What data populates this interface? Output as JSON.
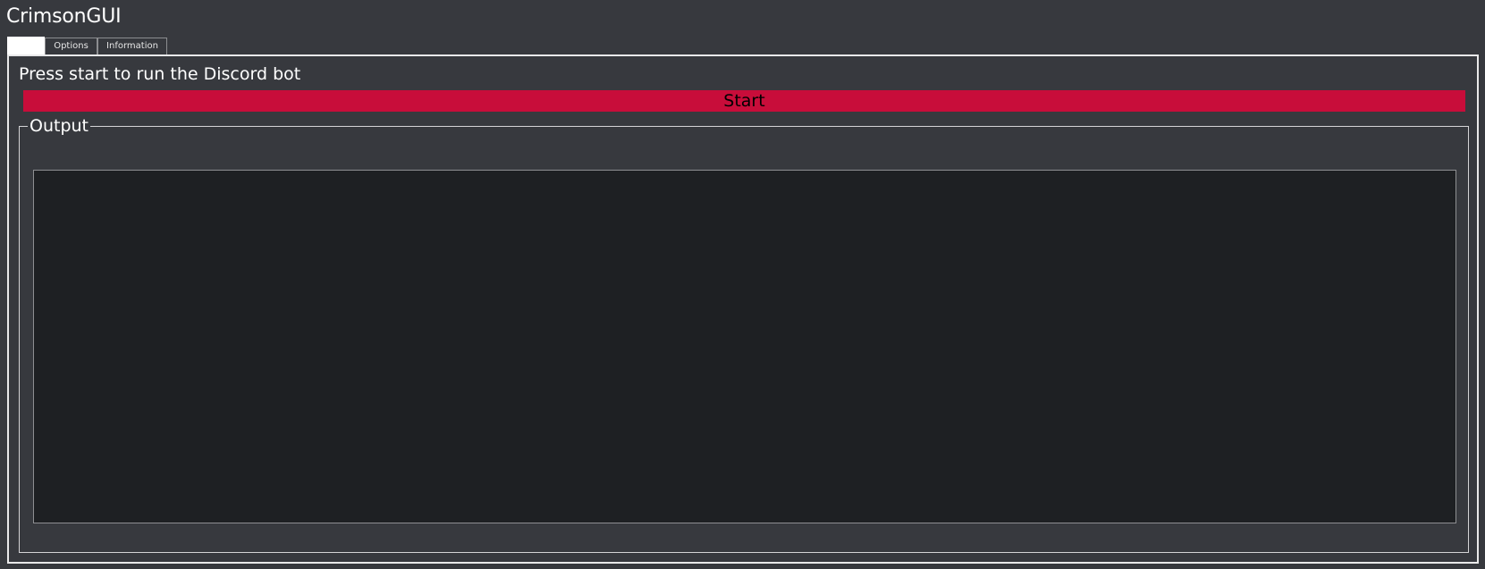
{
  "window": {
    "title": "CrimsonGUI"
  },
  "tabs": [
    {
      "label": "",
      "active": true
    },
    {
      "label": "Options",
      "active": false
    },
    {
      "label": "Information",
      "active": false
    }
  ],
  "main": {
    "instruction": "Press start to run the Discord bot",
    "start_label": "Start",
    "output": {
      "legend": "Output",
      "content": ""
    }
  },
  "colors": {
    "background": "#37393e",
    "accent": "#c80d3a",
    "output_background": "#1e2023",
    "text": "#ffffff"
  }
}
